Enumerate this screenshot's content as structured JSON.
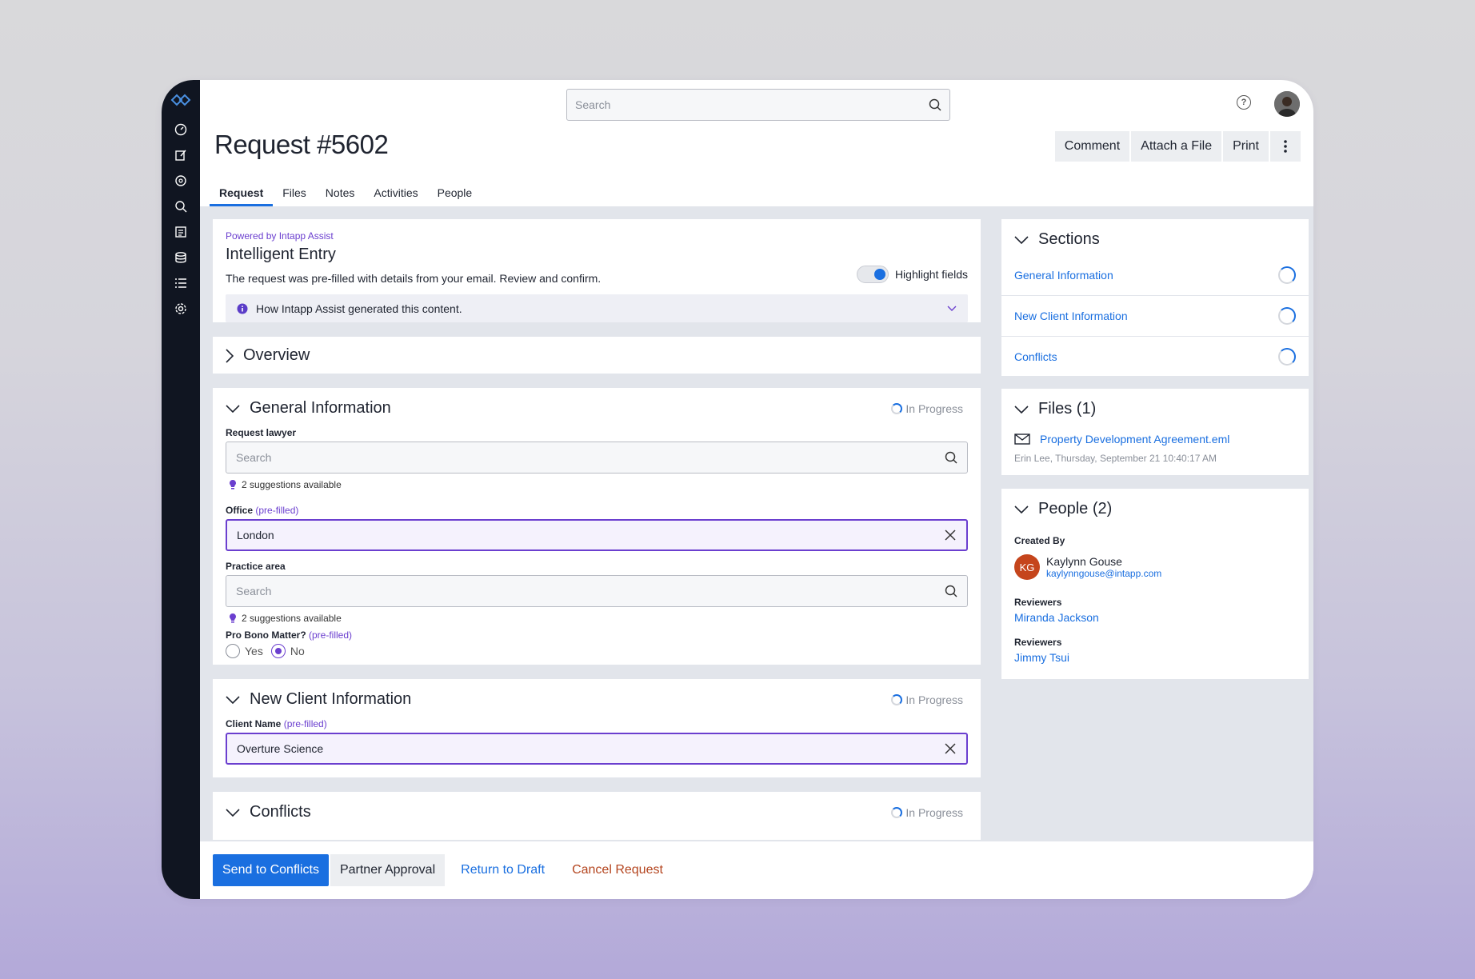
{
  "header": {
    "search_placeholder": "Search",
    "page_title": "Request #5602",
    "actions": [
      "Comment",
      "Attach a File",
      "Print"
    ]
  },
  "tabs": [
    "Request",
    "Files",
    "Notes",
    "Activities",
    "People"
  ],
  "intelligent_entry": {
    "powered_by": "Powered by Intapp Assist",
    "title": "Intelligent Entry",
    "description": "The request was pre-filled with details from your email. Review and confirm.",
    "toggle_label": "Highlight fields",
    "toggle_on": true,
    "info_text": "How Intapp Assist generated this content."
  },
  "overview": {
    "title": "Overview"
  },
  "general_information": {
    "title": "General Information",
    "status": "In Progress",
    "request_lawyer": {
      "label": "Request lawyer",
      "placeholder": "Search",
      "suggestions": "2 suggestions available"
    },
    "office": {
      "label": "Office",
      "prefilled": "(pre-filled)",
      "value": "London"
    },
    "practice_area": {
      "label": "Practice area",
      "placeholder": "Search",
      "suggestions": "2 suggestions available"
    },
    "pro_bono": {
      "label": "Pro Bono Matter?",
      "prefilled": "(pre-filled)",
      "options": [
        "Yes",
        "No"
      ],
      "selected": "No"
    }
  },
  "new_client_information": {
    "title": "New Client Information",
    "status": "In Progress",
    "client_name": {
      "label": "Client Name",
      "prefilled": "(pre-filled)",
      "value": "Overture Science"
    }
  },
  "conflicts": {
    "title": "Conflicts",
    "status": "In Progress"
  },
  "sections_panel": {
    "title": "Sections",
    "items": [
      "General Information",
      "New Client Information",
      "Conflicts"
    ]
  },
  "files_panel": {
    "title": "Files (1)",
    "file_name": "Property Development Agreement.eml",
    "file_meta": "Erin Lee, Thursday, September 21 10:40:17 AM"
  },
  "people_panel": {
    "title": "People (2)",
    "created_by_label": "Created By",
    "creator_initials": "KG",
    "creator_name": "Kaylynn Gouse",
    "creator_email": "kaylynngouse@intapp.com",
    "reviewers_label_1": "Reviewers",
    "reviewer_1": "Miranda Jackson",
    "reviewers_label_2": "Reviewers",
    "reviewer_2": "Jimmy Tsui"
  },
  "footer": {
    "send": "Send to Conflicts",
    "partner": "Partner Approval",
    "return": "Return to Draft",
    "cancel": "Cancel Request"
  },
  "colors": {
    "accent": "#1a6fe0",
    "assist_purple": "#6b3fcf",
    "danger": "#b4451f",
    "rail": "#101521"
  }
}
